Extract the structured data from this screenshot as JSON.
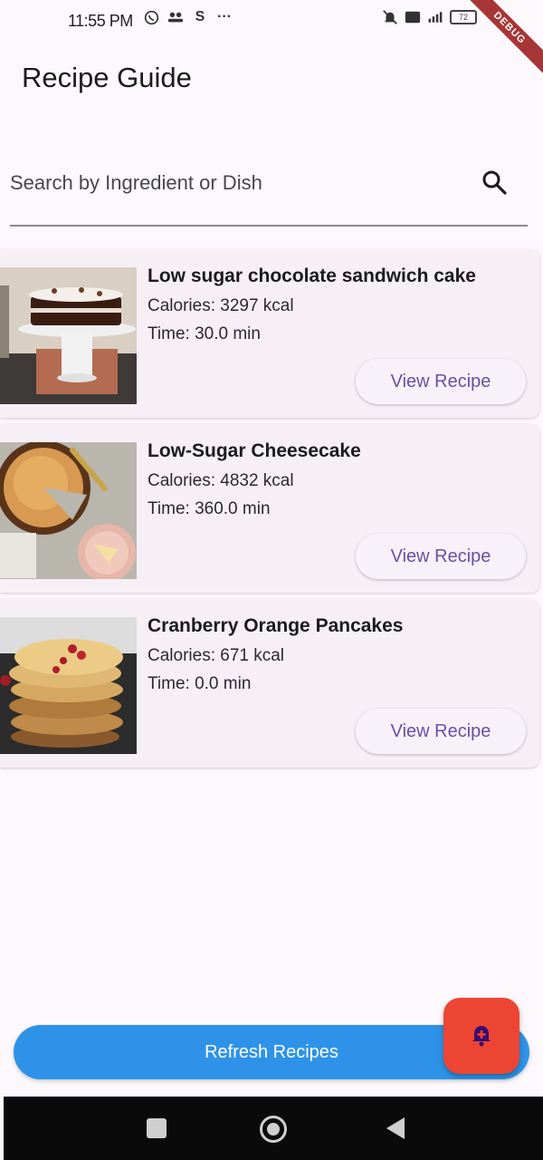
{
  "status_bar": {
    "time": "11:55 PM",
    "left_icons": [
      "whatsapp-icon",
      "group-icon",
      "s-app-icon",
      "more-dots-icon"
    ],
    "right_icons": [
      "mute-icon",
      "volte-icon",
      "signal-icon",
      "battery-icon"
    ],
    "battery": "72",
    "debug_label": "DEBUG"
  },
  "app_bar": {
    "title": "Recipe Guide"
  },
  "search": {
    "placeholder": "Search by Ingredient or Dish",
    "value": "",
    "icon": "search-icon"
  },
  "recipes": [
    {
      "title": "Low sugar chocolate sandwich cake",
      "calories": "Calories: 3297 kcal",
      "time": "Time: 30.0 min",
      "button": "View Recipe"
    },
    {
      "title": "Low-Sugar Cheesecake",
      "calories": "Calories: 4832 kcal",
      "time": "Time: 360.0 min",
      "button": "View Recipe"
    },
    {
      "title": "Cranberry Orange Pancakes",
      "calories": "Calories: 671 kcal",
      "time": "Time: 0.0 min",
      "button": "View Recipe"
    }
  ],
  "actions": {
    "refresh_label": "Refresh Recipes",
    "fab_icon": "bell-add-icon"
  },
  "colors": {
    "accent": "#6750a4",
    "refresh": "#2e93e8",
    "fab": "#ec4534",
    "fab_icon": "#3b0a6e"
  },
  "nav": {
    "icons": [
      "recents-icon",
      "home-icon",
      "back-icon"
    ]
  }
}
